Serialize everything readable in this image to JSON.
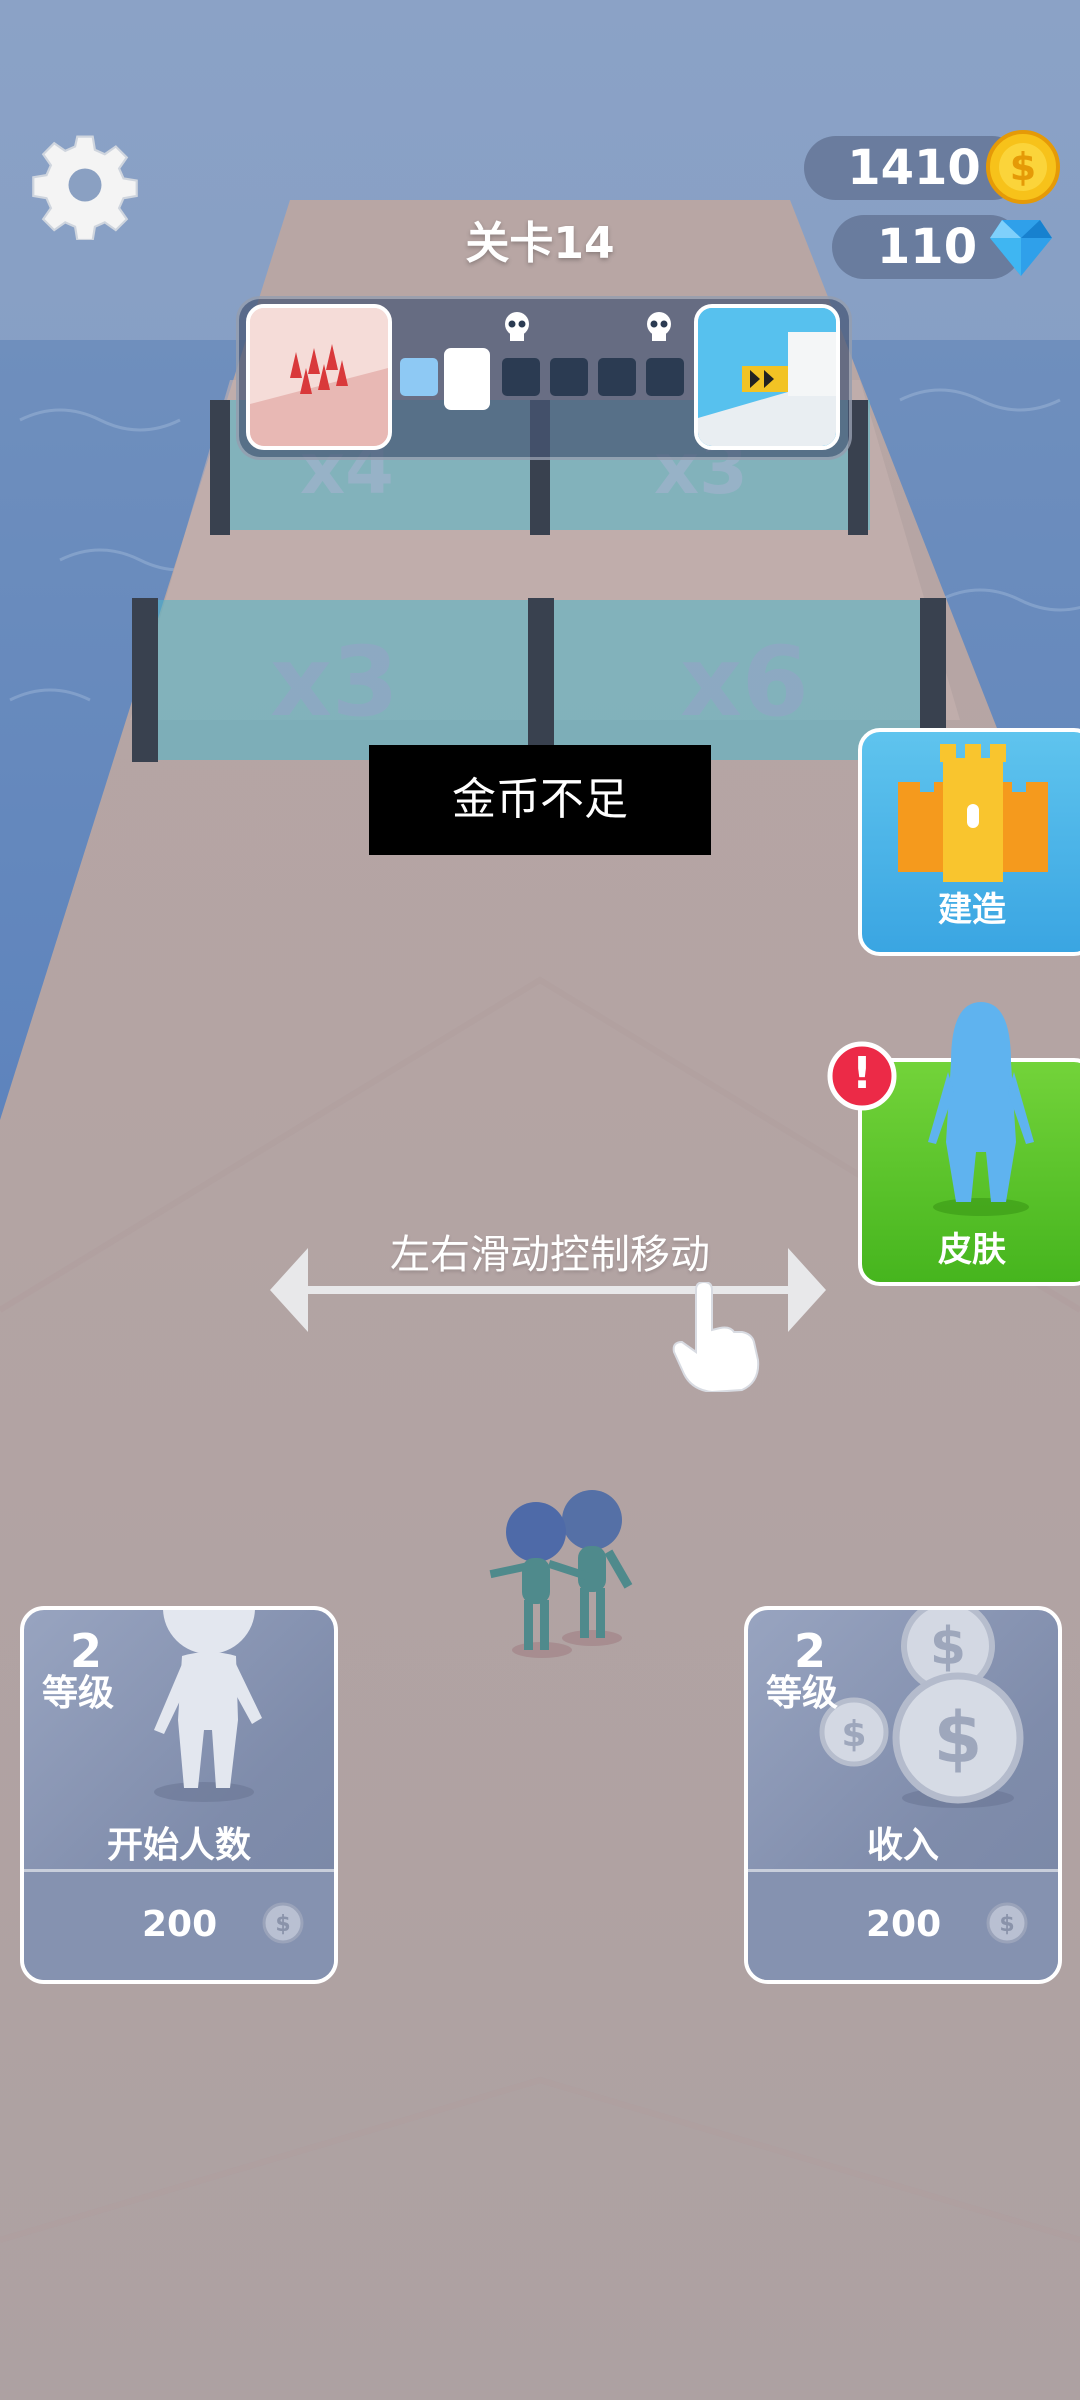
{
  "hud": {
    "coins": "1410",
    "gems": "110",
    "level_title": "关卡14",
    "icons": {
      "settings": "gear-icon",
      "coin": "coin-icon",
      "gem": "gem-icon",
      "skull": "skull-icon"
    }
  },
  "progress": {
    "total_stages": 6,
    "completed": 1,
    "current": 2
  },
  "track": {
    "gate_far_left": "x4",
    "gate_far_right": "x3",
    "gate_near_left": "x3",
    "gate_near_right": "x6"
  },
  "toast": {
    "text": "金币不足"
  },
  "side_buttons": {
    "build_label": "建造",
    "skin_label": "皮肤",
    "skin_alert": "!"
  },
  "hint": {
    "text": "左右滑动控制移动"
  },
  "cards": {
    "start_count": {
      "level": "2",
      "level_label": "等级",
      "title": "开始人数",
      "price": "200"
    },
    "income": {
      "level": "2",
      "level_label": "等级",
      "title": "收入",
      "price": "200"
    }
  },
  "colors": {
    "accent_blue": "#3aa5e2",
    "accent_green": "#46b51e",
    "coin_gold": "#f7c21a",
    "card_bg": "#8592b0"
  }
}
